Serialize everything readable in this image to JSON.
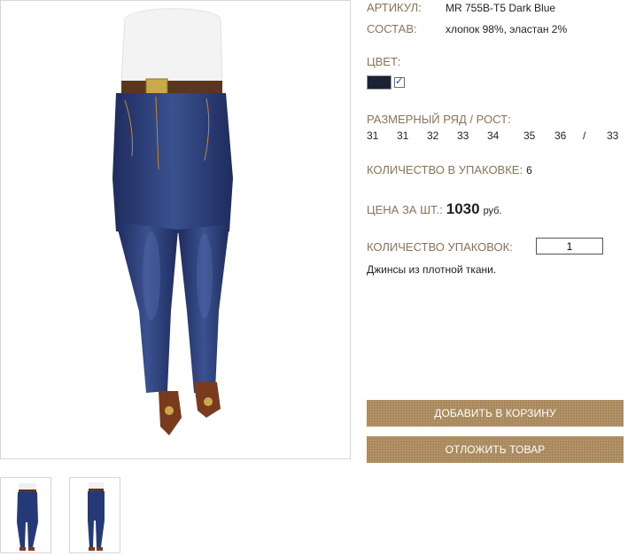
{
  "product": {
    "article_label": "АРТИКУЛ:",
    "article_value": "MR 755B-T5 Dark Blue",
    "composition_label": "СОСТАВ:",
    "composition_value": "хлопок 98%, эластан 2%",
    "color_label": "ЦВЕТ:",
    "color_swatch": "#1b2235",
    "color_selected": true,
    "size_label": "РАЗМЕРНЫЙ РЯД / РОСТ:",
    "sizes": [
      "31",
      "31",
      "32",
      "33",
      "34",
      "35",
      "36",
      "/",
      "33"
    ],
    "pack_qty_label": "КОЛИЧЕСТВО В УПАКОВКЕ:",
    "pack_qty_value": "6",
    "price_label": "ЦЕНА ЗА ШТ.:",
    "price_value": "1030",
    "price_currency": "руб.",
    "packs_label": "КОЛИЧЕСТВО УПАКОВОК:",
    "packs_value": "1",
    "description": "Джинсы из плотной ткани."
  },
  "buttons": {
    "add_to_cart": "ДОБАВИТЬ В КОРЗИНУ",
    "defer": "ОТЛОЖИТЬ ТОВАР"
  },
  "gallery": {
    "thumbnails": [
      "jeans-front-thumbnail",
      "jeans-side-thumbnail"
    ]
  },
  "colors": {
    "label": "#8b7355",
    "button": "#a9885a",
    "denim": "#2a3d7a"
  }
}
